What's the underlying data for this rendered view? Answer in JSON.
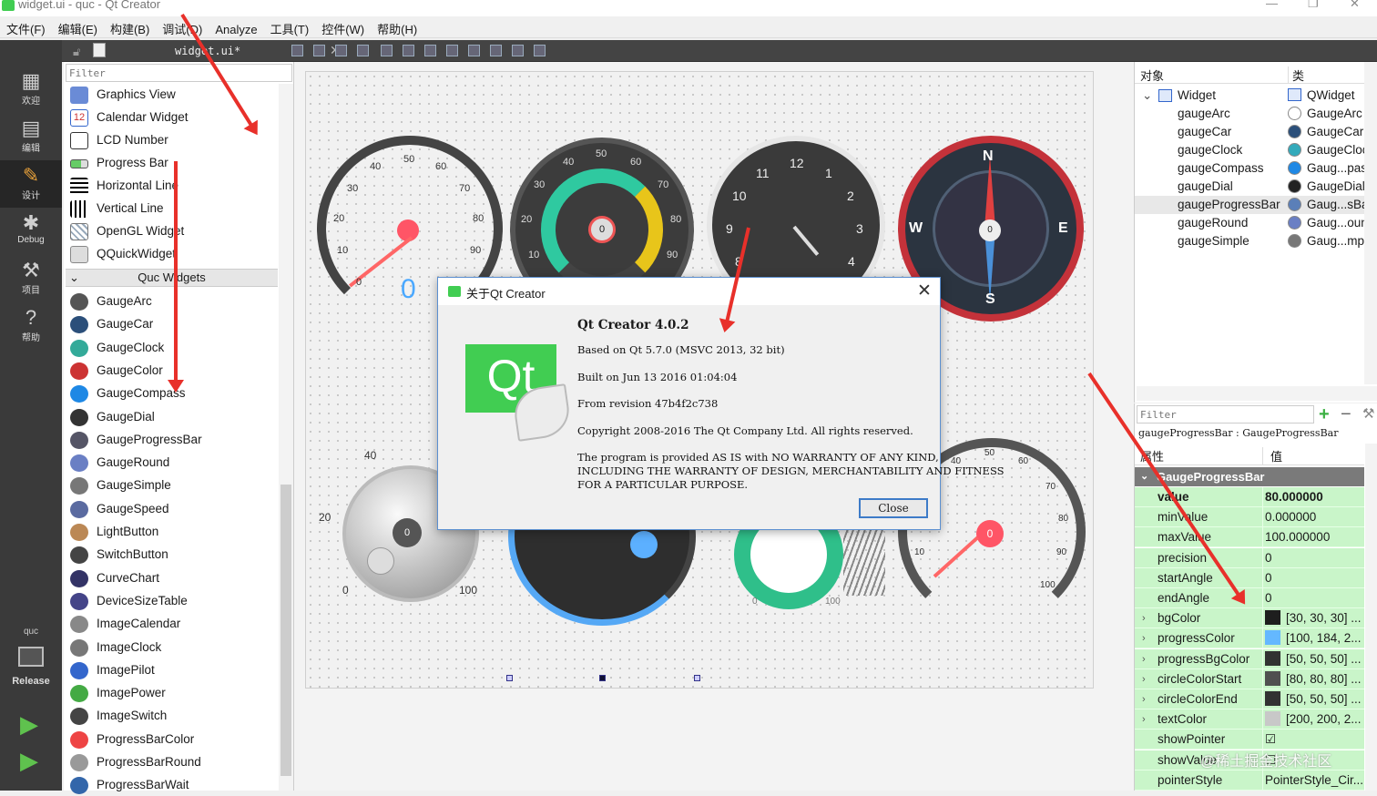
{
  "window": {
    "title": "widget.ui - quc - Qt Creator"
  },
  "menubar": [
    "文件(F)",
    "编辑(E)",
    "构建(B)",
    "调试(D)",
    "Analyze",
    "工具(T)",
    "控件(W)",
    "帮助(H)"
  ],
  "modes": [
    {
      "label": "欢迎",
      "icon": "grid-icon"
    },
    {
      "label": "编辑",
      "icon": "edit-icon"
    },
    {
      "label": "设计",
      "icon": "pencil-icon"
    },
    {
      "label": "Debug",
      "icon": "bug-icon"
    },
    {
      "label": "项目",
      "icon": "wrench-icon"
    },
    {
      "label": "帮助",
      "icon": "help-icon"
    }
  ],
  "kit": {
    "project": "quc",
    "config": "Release"
  },
  "editor": {
    "document": "widget.ui*"
  },
  "widgetbox": {
    "filter_placeholder": "Filter",
    "items_top": [
      "Graphics View",
      "Calendar Widget",
      "LCD Number",
      "Progress Bar",
      "Horizontal Line",
      "Vertical Line",
      "OpenGL Widget",
      "QQuickWidget"
    ],
    "category": "Quc Widgets",
    "items_quc": [
      "GaugeArc",
      "GaugeCar",
      "GaugeClock",
      "GaugeColor",
      "GaugeCompass",
      "GaugeDial",
      "GaugeProgressBar",
      "GaugeRound",
      "GaugeSimple",
      "GaugeSpeed",
      "LightButton",
      "SwitchButton",
      "CurveChart",
      "DeviceSizeTable",
      "ImageCalendar",
      "ImageClock",
      "ImagePilot",
      "ImagePower",
      "ImageSwitch",
      "ProgressBarColor",
      "ProgressBarRound",
      "ProgressBarWait"
    ]
  },
  "form": {
    "arc_ticks": [
      "0",
      "10",
      "20",
      "30",
      "40",
      "50",
      "60",
      "70",
      "80",
      "90"
    ],
    "arc_value": "0",
    "car_ticks": [
      "10",
      "20",
      "30",
      "40",
      "50",
      "60",
      "70",
      "80",
      "90"
    ],
    "car_value": "0",
    "clock_numbers": [
      "12",
      "1",
      "2",
      "3",
      "4",
      "8",
      "9",
      "10",
      "11"
    ],
    "compass": {
      "n": "N",
      "e": "E",
      "s": "S",
      "w": "W",
      "value": "0"
    },
    "dial_ticks": [
      "0",
      "20",
      "40",
      "100"
    ],
    "dial_value": "0",
    "simple_ticks": [
      "0",
      "100"
    ],
    "speed_ticks": [
      "10",
      "40",
      "50",
      "60",
      "70",
      "80",
      "90",
      "100"
    ],
    "speed_value": "0"
  },
  "dialog": {
    "title": "关于Qt Creator",
    "heading": "Qt Creator 4.0.2",
    "lines": [
      "Based on Qt 5.7.0 (MSVC 2013, 32 bit)",
      "Built on Jun 13 2016 01:04:04",
      "From revision 47b4f2c738",
      "Copyright 2008-2016 The Qt Company Ltd. All rights reserved.",
      "The program is provided AS IS with NO WARRANTY OF ANY KIND,\nINCLUDING THE WARRANTY OF DESIGN, MERCHANTABILITY AND FITNESS\nFOR A PARTICULAR PURPOSE."
    ],
    "logo_text": "Qt",
    "close_label": "Close"
  },
  "objinspector": {
    "col_object": "对象",
    "col_class": "类",
    "root": {
      "name": "Widget",
      "class": "QWidget"
    },
    "rows": [
      {
        "name": "gaugeArc",
        "class": "GaugeArc"
      },
      {
        "name": "gaugeCar",
        "class": "GaugeCar"
      },
      {
        "name": "gaugeClock",
        "class": "GaugeClock"
      },
      {
        "name": "gaugeCompass",
        "class": "Gaug...pass"
      },
      {
        "name": "gaugeDial",
        "class": "GaugeDial"
      },
      {
        "name": "gaugeProgressBar",
        "class": "Gaug...sBar"
      },
      {
        "name": "gaugeRound",
        "class": "Gaug...ound"
      },
      {
        "name": "gaugeSimple",
        "class": "Gaug...mple"
      }
    ]
  },
  "propeditor": {
    "filter_placeholder": "Filter",
    "class_line": "gaugeProgressBar : GaugeProgressBar",
    "col_property": "属性",
    "col_value": "值",
    "group": "GaugeProgressBar",
    "rows": [
      {
        "name": "value",
        "value": "80.000000"
      },
      {
        "name": "minValue",
        "value": "0.000000"
      },
      {
        "name": "maxValue",
        "value": "100.000000"
      },
      {
        "name": "precision",
        "value": "0"
      },
      {
        "name": "startAngle",
        "value": "0"
      },
      {
        "name": "endAngle",
        "value": "0"
      },
      {
        "name": "bgColor",
        "value": "[30, 30, 30] ...",
        "swatch": "#1e1e1e"
      },
      {
        "name": "progressColor",
        "value": "[100, 184, 2...",
        "swatch": "#64b8ff"
      },
      {
        "name": "progressBgColor",
        "value": "[50, 50, 50] ...",
        "swatch": "#323232"
      },
      {
        "name": "circleColorStart",
        "value": "[80, 80, 80] ...",
        "swatch": "#505050"
      },
      {
        "name": "circleColorEnd",
        "value": "[50, 50, 50] ...",
        "swatch": "#323232"
      },
      {
        "name": "textColor",
        "value": "[200, 200, 2...",
        "swatch": "#c8c8c8"
      },
      {
        "name": "showPointer",
        "value": "☑"
      },
      {
        "name": "showValue",
        "value": "☐"
      },
      {
        "name": "pointerStyle",
        "value": "PointerStyle_Cir..."
      }
    ]
  },
  "watermark": "@稀土掘金技术社区",
  "colors": {
    "accent": "#41cd52",
    "arrow": "#e8302a",
    "property_bg": "#c9f5c9",
    "selection": "#3d7bc8"
  }
}
